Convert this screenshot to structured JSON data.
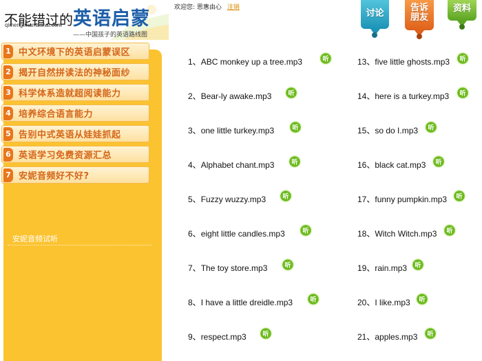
{
  "header": {
    "logo": {
      "part1": "不能错过的",
      "part2": "英语启蒙",
      "domain": "qimeng.mamashai.com",
      "subtitle": "——中国孩子的英语路线图"
    },
    "welcome": {
      "text": "欢迎您: 恩惠由心",
      "logout": "注销"
    },
    "tabs": [
      {
        "label": "讨论",
        "color": "#2aa4c4",
        "icon": "chat-bubble"
      },
      {
        "label": "告诉朋友",
        "line1": "告诉",
        "line2": "朋友",
        "color": "#ee7429",
        "icon": "chat-bubble"
      },
      {
        "label": "资料",
        "color": "#74b935",
        "icon": "chat-bubble"
      }
    ]
  },
  "sidebar": {
    "accent": "#fcc331",
    "items": [
      {
        "num": "1",
        "label": "中文环境下的英语启蒙误区"
      },
      {
        "num": "2",
        "label": "揭开自然拼读法的神秘面纱"
      },
      {
        "num": "3",
        "label": "科学体系造就超阅读能力"
      },
      {
        "num": "4",
        "label": "培养综合语言能力"
      },
      {
        "num": "5",
        "label": "告别中式英语从娃娃抓起"
      },
      {
        "num": "6",
        "label": "英语学习免费资源汇总"
      },
      {
        "num": "7",
        "label": "安妮音频好不好?"
      }
    ],
    "sub_link": "安妮音频试听"
  },
  "tracks": {
    "listen_label": "听",
    "listen_color": "#6dbb1e",
    "left": [
      {
        "num": "1、",
        "title": "ABC monkey up a tree.mp3"
      },
      {
        "num": "2、",
        "title": "Bear-ly awake.mp3"
      },
      {
        "num": "3、",
        "title": "one little turkey.mp3"
      },
      {
        "num": "4、",
        "title": "Alphabet chant.mp3"
      },
      {
        "num": "5、",
        "title": "Fuzzy wuzzy.mp3"
      },
      {
        "num": "6、",
        "title": "eight little candles.mp3"
      },
      {
        "num": "7、",
        "title": "The toy store.mp3"
      },
      {
        "num": "8、",
        "title": "I have a little dreidle.mp3"
      },
      {
        "num": "9、",
        "title": "respect.mp3"
      }
    ],
    "right": [
      {
        "num": "13、",
        "title": "five little ghosts.mp3"
      },
      {
        "num": "14、",
        "title": "here is a turkey.mp3"
      },
      {
        "num": "15、",
        "title": "so do I.mp3"
      },
      {
        "num": "16、",
        "title": "black cat.mp3"
      },
      {
        "num": "17、",
        "title": "funny pumpkin.mp3"
      },
      {
        "num": "18、",
        "title": "Witch Witch.mp3"
      },
      {
        "num": "19、",
        "title": "rain.mp3"
      },
      {
        "num": "20、",
        "title": "I like.mp3"
      },
      {
        "num": "21、",
        "title": "apples.mp3"
      }
    ]
  }
}
